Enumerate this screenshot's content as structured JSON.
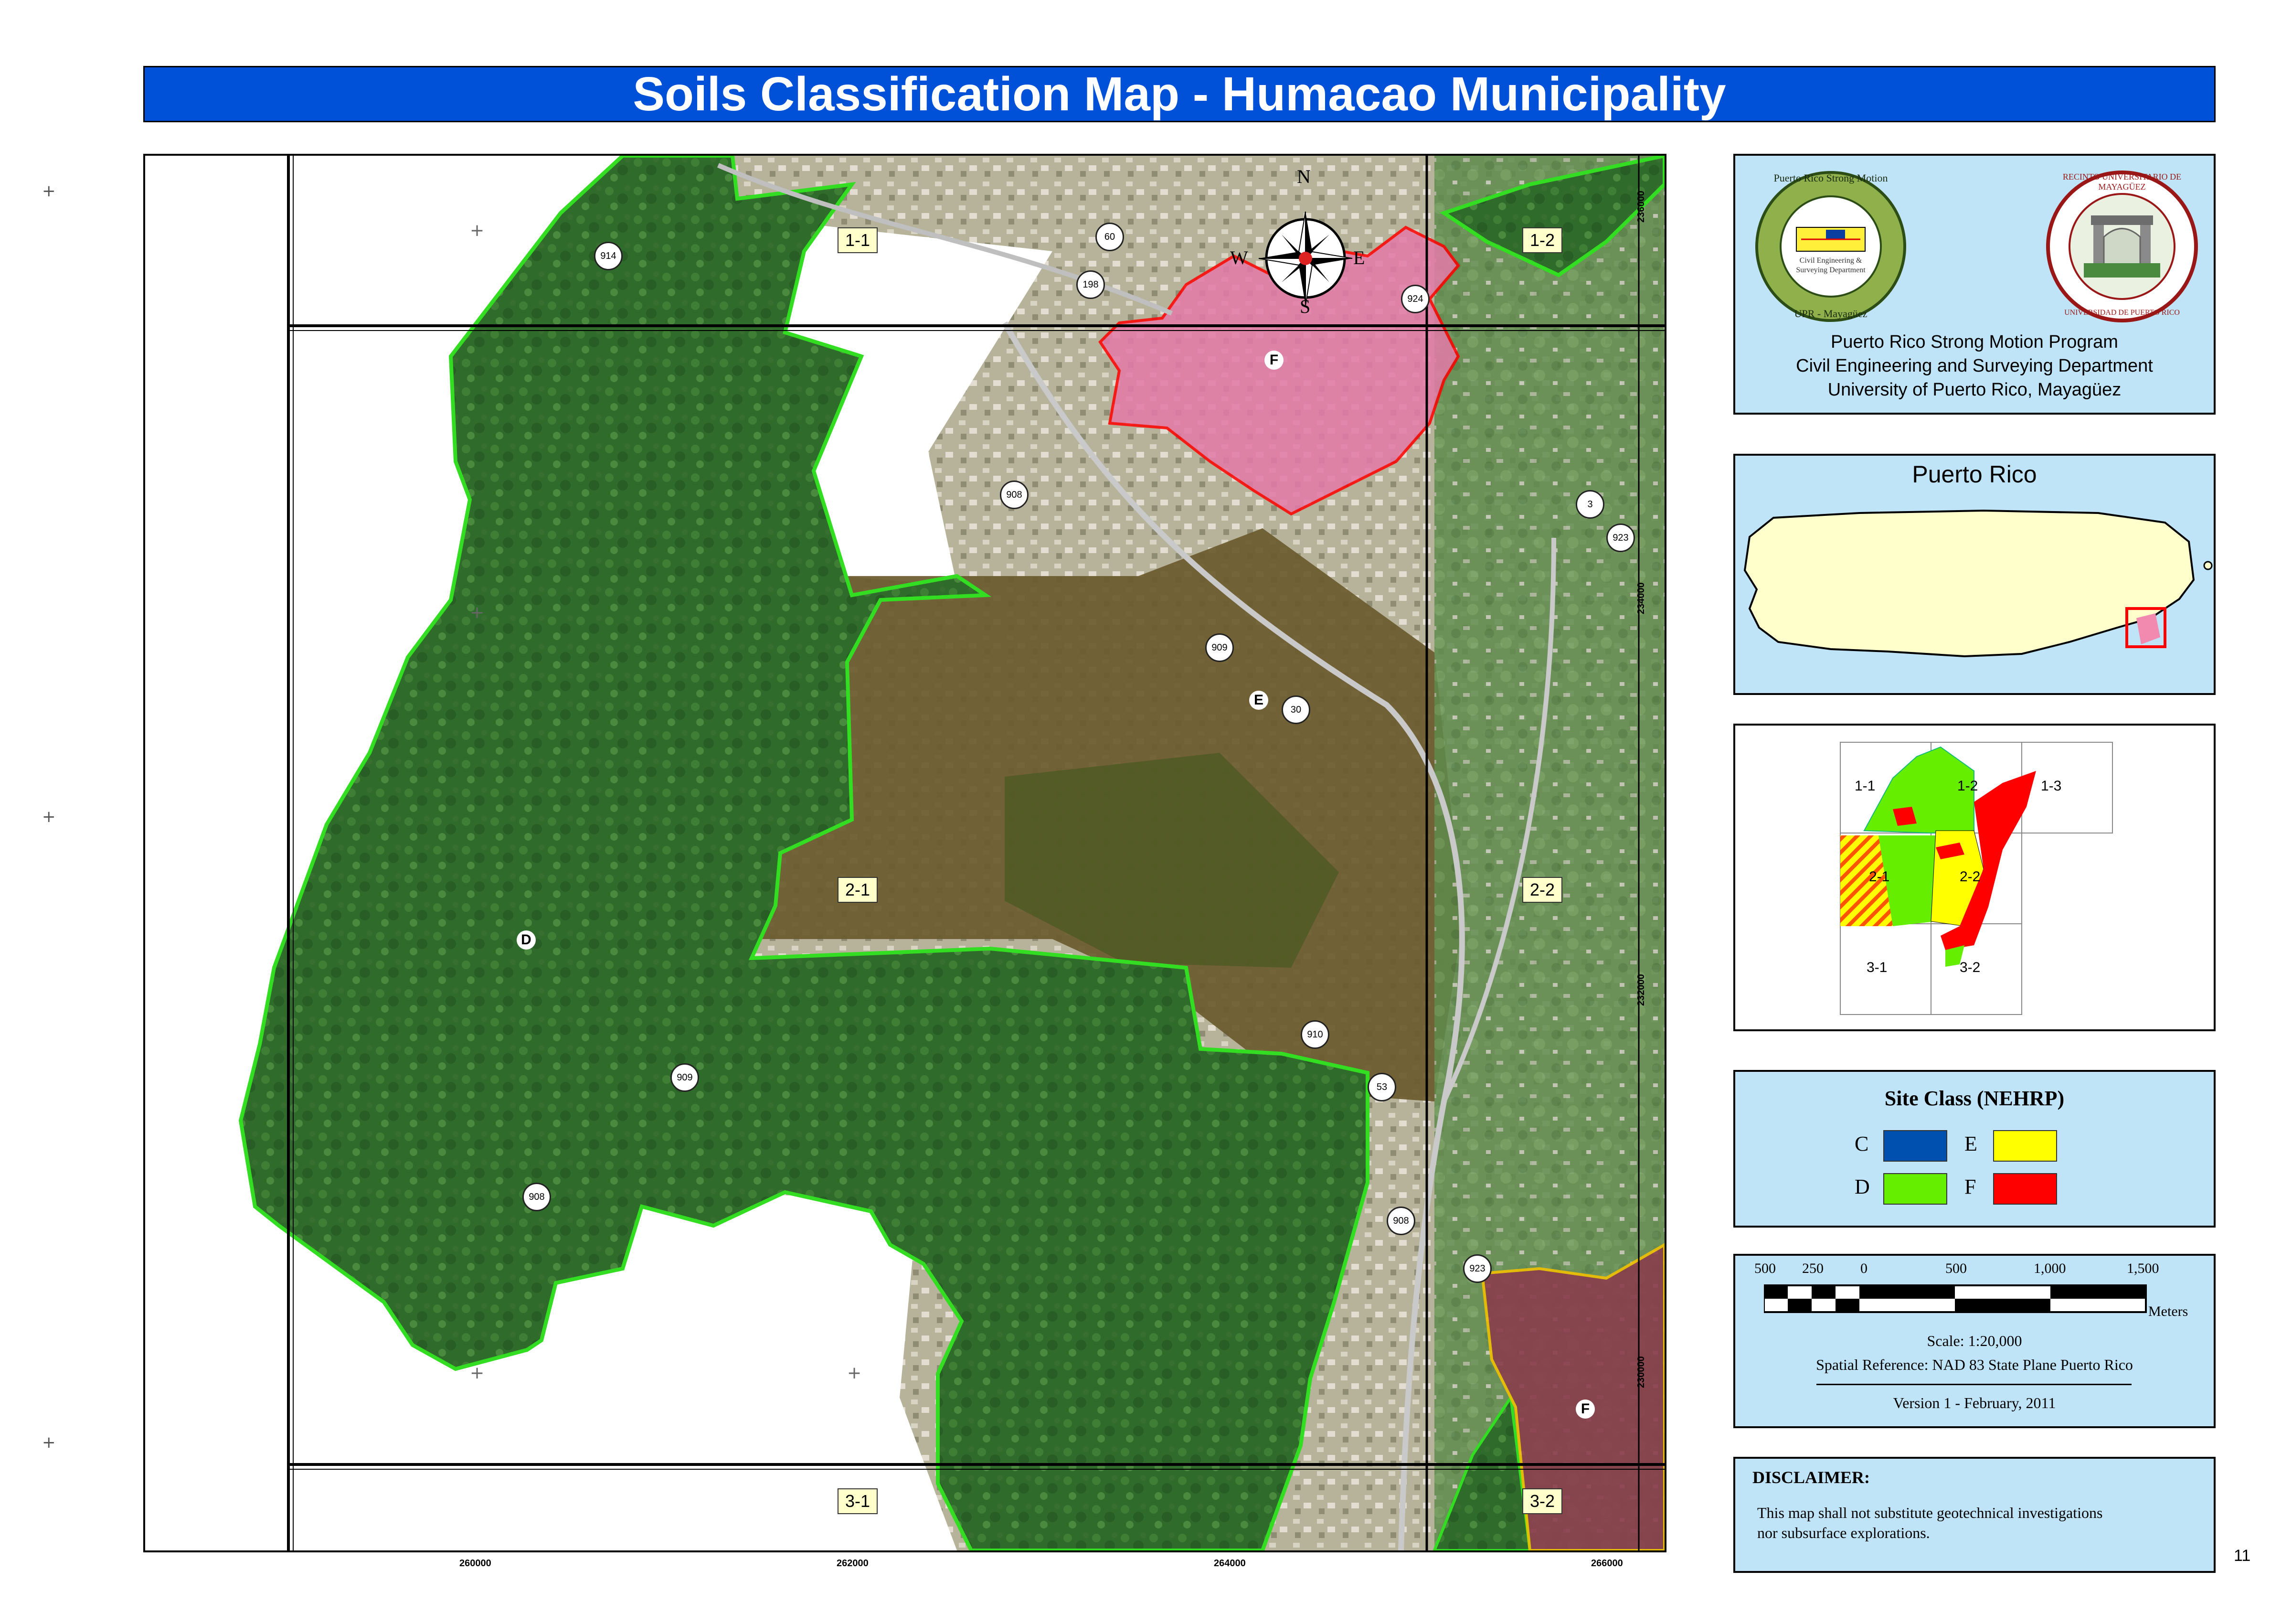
{
  "title": "Soils Classification Map - Humacao Municipality",
  "page_number": "11",
  "map": {
    "compass": {
      "n": "N",
      "s": "S",
      "e": "E",
      "w": "W"
    },
    "x_ticks": [
      "260000",
      "262000",
      "264000",
      "266000"
    ],
    "y_ticks": [
      "236000",
      "234000",
      "232000",
      "230000"
    ],
    "sheets": [
      "1-1",
      "1-2",
      "2-1",
      "2-2",
      "3-1",
      "3-2"
    ],
    "roads": [
      "914",
      "60",
      "198",
      "924",
      "908",
      "3",
      "923",
      "909",
      "30",
      "910",
      "53",
      "909",
      "908",
      "908",
      "923"
    ],
    "class_labels": [
      "F",
      "E",
      "D",
      "F"
    ],
    "colors": {
      "vegetation_dark": "#2e6a2a",
      "vegetation_light": "#5f8a4a",
      "class_e_area": "#6b5a2c",
      "class_f_area": "#e47aa8",
      "class_d_boundary": "#33dd22",
      "class_f_boundary": "#ff0000",
      "yellow_boundary": "#f0c000"
    }
  },
  "logos_panel": {
    "seal_left": {
      "ring_text_top": "Puerto Rico Strong Motion",
      "ring_text_bottom": "UPR - Mayagüez",
      "inner_text_1": "Civil Engineering &",
      "inner_text_2": "Surveying Department"
    },
    "seal_right": {
      "ring_text_top": "RECINTO UNIVERSITARIO DE MAYAGÜEZ",
      "ring_text_bottom": "UNIVERSIDAD DE PUERTO RICO"
    },
    "line1": "Puerto Rico Strong Motion Program",
    "line2": "Civil Engineering and Surveying Department",
    "line3": "University of Puerto Rico, Mayagüez"
  },
  "locator_panel": {
    "title": "Puerto Rico"
  },
  "index_panel": {
    "cells": [
      "1-1",
      "1-2",
      "1-3",
      "2-1",
      "2-2",
      "3-1",
      "3-2"
    ]
  },
  "legend": {
    "title": "Site Class (NEHRP)",
    "items": [
      {
        "label": "C",
        "color": "#0050b0"
      },
      {
        "label": "E",
        "color": "#ffff00"
      },
      {
        "label": "D",
        "color": "#66ee00"
      },
      {
        "label": "F",
        "color": "#ff0000"
      }
    ]
  },
  "scale_panel": {
    "labels": [
      "500",
      "250",
      "0",
      "500",
      "1,000",
      "1,500"
    ],
    "unit": "Meters",
    "scale": "Scale:  1:20,000",
    "spatial_reference": "Spatial Reference: NAD 83 State Plane Puerto Rico",
    "version": "Version 1 - February, 2011"
  },
  "disclaimer": {
    "heading": "DISCLAIMER:",
    "text_line1": "This  map shall not substitute  geotechnical investigations",
    "text_line2": "nor subsurface explorations."
  }
}
